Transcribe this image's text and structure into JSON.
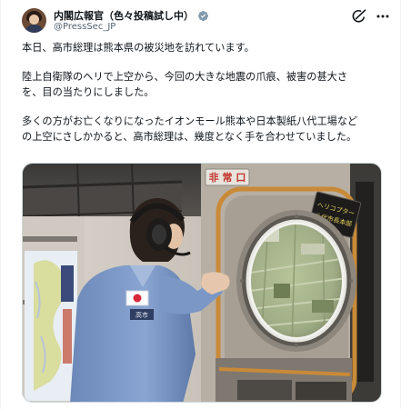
{
  "author": {
    "name": "内閣広報官（色々投稿試し中）",
    "handle": "@PressSec_JP",
    "verified_color": "#829aab",
    "avatar_icon": "person-avatar"
  },
  "actions": {
    "grok_icon": "grok-icon",
    "more_icon": "more-icon"
  },
  "tweet": {
    "line1": "本日、高市総理は熊本県の被災地を訪れています。",
    "line2": "陸上自衛隊のヘリで上空から、今回の大きな地震の爪痕、被害の甚大さ",
    "line3": "を、目の当たりにしました。",
    "line4": "多くの方がお亡くなりになったイオンモール熊本や日本製紙八代工場など",
    "line5": "の上空にさしかかると、高市総理は、幾度となく手を合わせていました。"
  },
  "photo": {
    "exit_sign": "非 常 口",
    "plate_line1": "ヘリコプター",
    "plate_line2": "八代市長本部"
  },
  "colors": {
    "text": "#0f1419",
    "secondary": "#536471",
    "border": "#cfd9de"
  }
}
